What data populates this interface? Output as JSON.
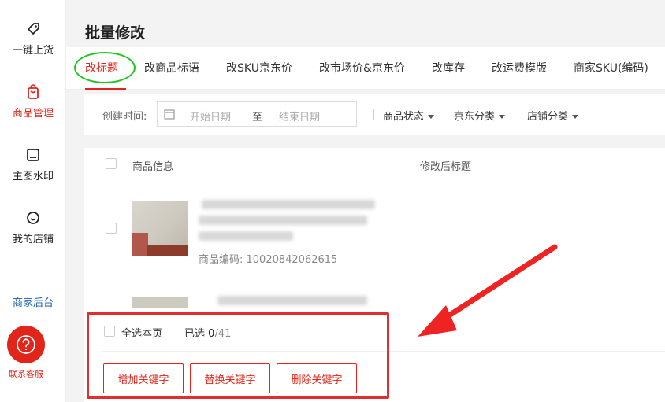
{
  "sidebar": {
    "items": [
      {
        "label": "一键上货",
        "icon": "tag-icon"
      },
      {
        "label": "商品管理",
        "icon": "shopping-bag-icon"
      },
      {
        "label": "主图水印",
        "icon": "image-watermark-icon"
      },
      {
        "label": "我的店铺",
        "icon": "store-icon"
      }
    ],
    "backend_link": "商家后台",
    "help_label": "联系客服",
    "accent_color": "#e1251b"
  },
  "page": {
    "title": "批量修改",
    "tabs": [
      "改标题",
      "改商品标语",
      "改SKU京东价",
      "改市场价&京东价",
      "改库存",
      "改运费模版",
      "商家SKU(编码)"
    ]
  },
  "filter": {
    "created_label": "创建时间:",
    "start_placeholder": "开始日期",
    "to_label": "至",
    "end_placeholder": "结束日期",
    "status_dropdown": "商品状态",
    "jd_category_dropdown": "京东分类",
    "shop_category_dropdown": "店铺分类"
  },
  "table": {
    "headers": {
      "product_info": "商品信息",
      "new_title": "修改后标题"
    },
    "rows": [
      {
        "code_label": "商品编码: 10020842062615"
      }
    ]
  },
  "footer": {
    "select_all_label": "全选本页",
    "selected_prefix": "已选",
    "selected_count": "0",
    "total": "/41",
    "buttons": {
      "add_keyword": "增加关键字",
      "replace_keyword": "替换关键字",
      "delete_keyword": "删除关键字"
    }
  }
}
